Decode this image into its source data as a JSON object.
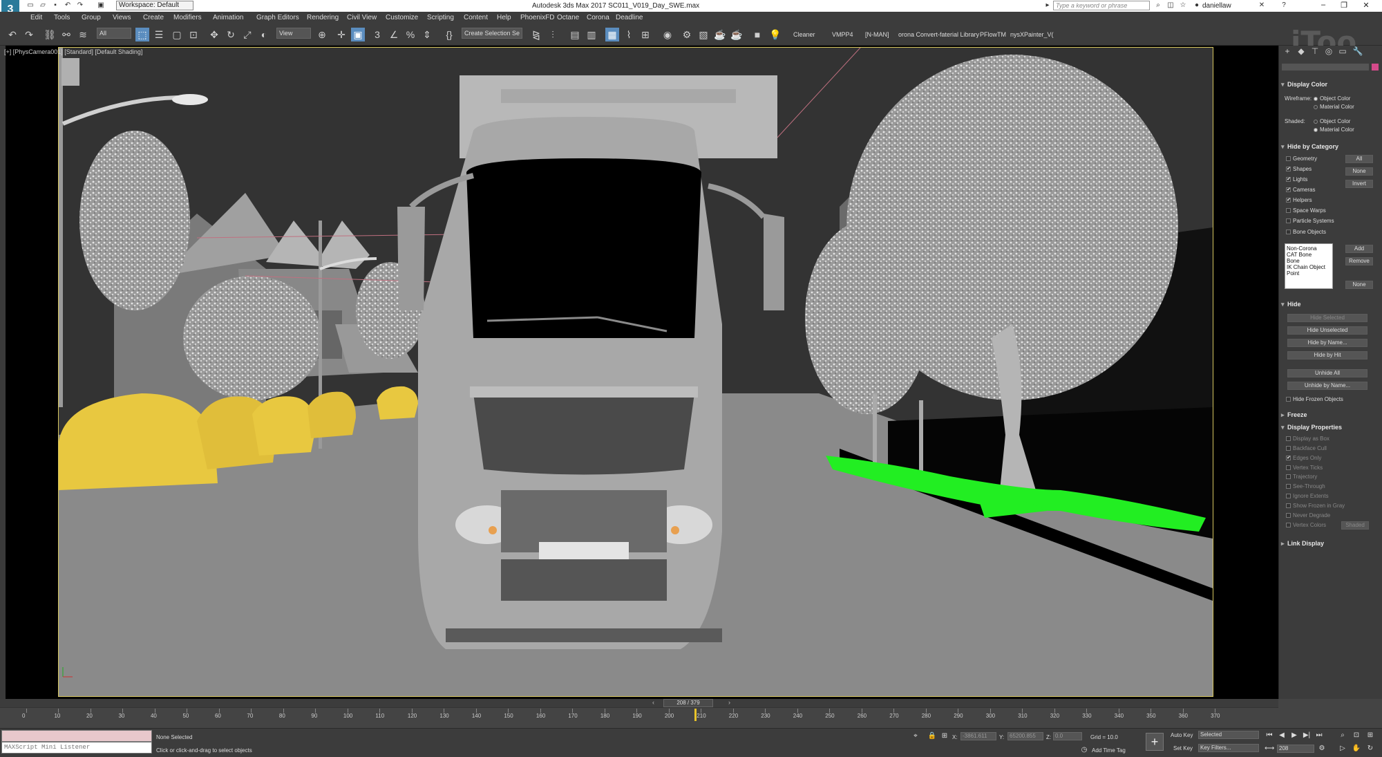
{
  "app": {
    "title": "Autodesk 3ds Max 2017    SC011_V019_Day_SWE.max",
    "icon_label": "3",
    "workspace": "Workspace: Default",
    "search_placeholder": "Type a keyword or phrase",
    "user": "daniellaw",
    "watermark": "iToo"
  },
  "menu": [
    "Edit",
    "Tools",
    "Group",
    "Views",
    "Create",
    "Modifiers",
    "Animation",
    "Graph Editors",
    "Rendering",
    "Civil View",
    "Customize",
    "Scripting",
    "Content",
    "Help",
    "PhoenixFD",
    "Octane",
    "Corona",
    "Deadline"
  ],
  "toolbar": {
    "filter": "All",
    "coord": "View",
    "selection_set": "Create Selection Se",
    "labels": [
      "Cleaner",
      "VMPP4",
      "[N-MAN]",
      "orona Convert-faterial Library",
      "PFlowTM",
      "nysXPainter_V("
    ]
  },
  "viewport": {
    "label": "[+] [PhysCamera001] [Standard] [Default Shading]"
  },
  "panel": {
    "display_color": {
      "title": "Display Color",
      "wireframe_label": "Wireframe:",
      "shaded_label": "Shaded:",
      "opt_object": "Object Color",
      "opt_material": "Material Color"
    },
    "hide_by_category": {
      "title": "Hide by Category",
      "items": [
        {
          "label": "Geometry",
          "checked": false
        },
        {
          "label": "Shapes",
          "checked": true
        },
        {
          "label": "Lights",
          "checked": true
        },
        {
          "label": "Cameras",
          "checked": true
        },
        {
          "label": "Helpers",
          "checked": true
        },
        {
          "label": "Space Warps",
          "checked": false
        },
        {
          "label": "Particle Systems",
          "checked": false
        },
        {
          "label": "Bone Objects",
          "checked": false
        }
      ],
      "btn_all": "All",
      "btn_none": "None",
      "btn_invert": "Invert",
      "list": [
        "Non-Corona",
        "CAT Bone",
        "Bone",
        "IK Chain Object",
        "Point"
      ],
      "btn_add": "Add",
      "btn_remove": "Remove",
      "btn_none2": "None"
    },
    "hide": {
      "title": "Hide",
      "buttons": [
        "Hide Selected",
        "Hide Unselected",
        "Hide by Name...",
        "Hide by Hit",
        "Unhide All",
        "Unhide by Name..."
      ],
      "frozen": "Hide Frozen Objects"
    },
    "freeze": {
      "title": "Freeze"
    },
    "display_properties": {
      "title": "Display Properties",
      "items": [
        {
          "label": "Display as Box",
          "checked": false
        },
        {
          "label": "Backface Cull",
          "checked": false
        },
        {
          "label": "Edges Only",
          "checked": true
        },
        {
          "label": "Vertex Ticks",
          "checked": false
        },
        {
          "label": "Trajectory",
          "checked": false
        },
        {
          "label": "See-Through",
          "checked": false
        },
        {
          "label": "Ignore Extents",
          "checked": false
        },
        {
          "label": "Show Frozen in Gray",
          "checked": false
        },
        {
          "label": "Never Degrade",
          "checked": false
        },
        {
          "label": "Vertex Colors",
          "checked": false
        }
      ],
      "shaded_btn": "Shaded"
    },
    "link_display": {
      "title": "Link Display"
    }
  },
  "timeline": {
    "frame_indicator": "208 / 379",
    "current_frame": 208,
    "total_frames": 379,
    "ticks": [
      "0",
      "10",
      "20",
      "30",
      "40",
      "50",
      "60",
      "70",
      "80",
      "90",
      "100",
      "110",
      "120",
      "130",
      "140",
      "150",
      "160",
      "170",
      "180",
      "190",
      "200",
      "210",
      "220",
      "230",
      "240",
      "250",
      "260",
      "270",
      "280",
      "290",
      "300",
      "310",
      "320",
      "330",
      "340",
      "350",
      "360",
      "370"
    ]
  },
  "status": {
    "listener": "MAXScript Mini Listener",
    "selection": "None Selected",
    "prompt": "Click or click-and-drag to select objects",
    "x_label": "X:",
    "x_value": "-3861.611",
    "y_label": "Y:",
    "y_value": "65200.855",
    "z_label": "Z:",
    "z_value": "0.0",
    "grid": "Grid = 10.0",
    "add_time_tag": "Add Time Tag",
    "auto_key": "Auto Key",
    "set_key": "Set Key",
    "selected": "Selected",
    "key_filters": "Key Filters...",
    "frame_field": "208"
  },
  "colors": {
    "accent_active": "#5b8dbf",
    "viewport_border": "#d8c860",
    "car_yellow": "#e8c840",
    "grass_green": "#22ee22"
  }
}
